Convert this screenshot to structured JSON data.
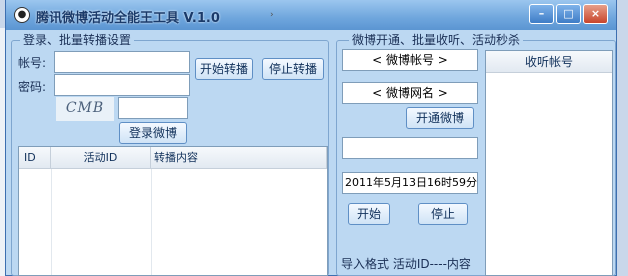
{
  "window": {
    "title": "腾讯微博活动全能王工具 V.1.0",
    "title_arrow": "›",
    "minimize": "–",
    "maximize": "□",
    "close": "×"
  },
  "login": {
    "legend": "登录、批量转播设置",
    "account_label": "帐号:",
    "account_value": "",
    "password_label": "密码:",
    "password_value": "",
    "captcha_text": "CMB",
    "captcha_value": "",
    "start_repost": "开始转播",
    "stop_repost": "停止转播",
    "login_button": "登录微博",
    "table": {
      "columns": [
        "ID",
        "活动ID",
        "转播内容"
      ],
      "rows": []
    }
  },
  "weibo": {
    "legend": "微博开通、批量收听、活动秒杀",
    "account_field": "< 微博帐号 >",
    "nickname_field": "< 微博网名 >",
    "open_button": "开通微博",
    "time_value": "2011年5月13日16时59分5",
    "start_button": "开始",
    "stop_button": "停止",
    "import_format": "导入格式 活动ID----内容",
    "listen_column": "收听帐号"
  }
}
